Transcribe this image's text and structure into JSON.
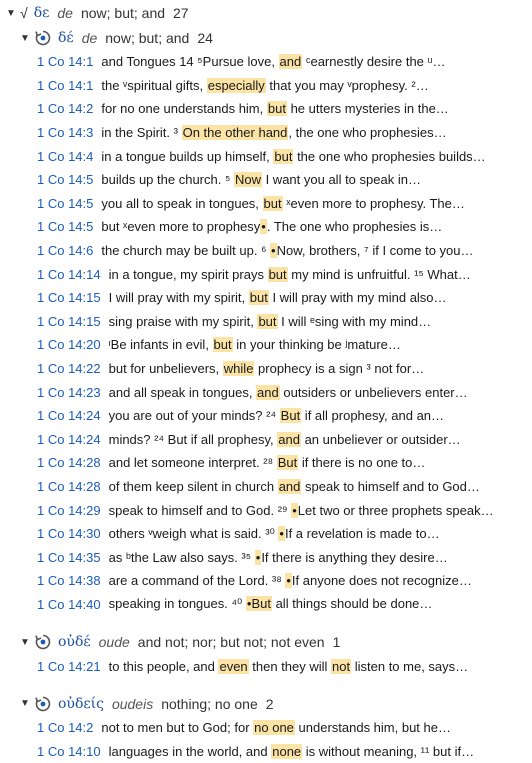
{
  "root": {
    "lemma": "δε",
    "translit": "de",
    "gloss": "now; but; and",
    "count": "27"
  },
  "groups": [
    {
      "lemma": "δέ",
      "translit": "de",
      "gloss": "now; but; and",
      "count": "24",
      "lines": [
        {
          "ref": "1 Co 14:1",
          "pre": "and Tongues 14 ⁵Pursue love, ",
          "hl": "and",
          "post": " ᶜearnestly desire the ᵘ…"
        },
        {
          "ref": "1 Co 14:1",
          "pre": "the ᵛspiritual gifts, ",
          "hl": "especially",
          "post": " that you may ᵛprophesy. ²…"
        },
        {
          "ref": "1 Co 14:2",
          "pre": "for no one understands him, ",
          "hl": "but",
          "post": " he utters mysteries in the…"
        },
        {
          "ref": "1 Co 14:3",
          "pre": "in the Spirit. ³ ",
          "hl": "On the other hand",
          "post": ", the one who prophesies…"
        },
        {
          "ref": "1 Co 14:4",
          "pre": "in a tongue builds up himself, ",
          "hl": "but",
          "post": " the one who prophesies builds…"
        },
        {
          "ref": "1 Co 14:5",
          "pre": "builds up the church. ⁵ ",
          "hl": "Now",
          "post": " I want you all to speak in…"
        },
        {
          "ref": "1 Co 14:5",
          "pre": "you all to speak in tongues, ",
          "hl": "but",
          "post": " ˣeven more to prophesy. The…"
        },
        {
          "ref": "1 Co 14:5",
          "pre": "but ˣeven more to prophesy",
          "hl": "•",
          "post": ". The one who prophesies is…"
        },
        {
          "ref": "1 Co 14:6",
          "pre": "the church may be built up. ⁶ ",
          "hl": "•",
          "post": "Now, brothers, ⁷ if I come to you…"
        },
        {
          "ref": "1 Co 14:14",
          "pre": "in a tongue, my spirit prays ",
          "hl": "but",
          "post": " my mind is unfruitful. ¹⁵ What…"
        },
        {
          "ref": "1 Co 14:15",
          "pre": "I will pray with my spirit, ",
          "hl": "but",
          "post": " I will pray with my mind also…"
        },
        {
          "ref": "1 Co 14:15",
          "pre": "sing praise with my spirit, ",
          "hl": "but",
          "post": " I will ᵉsing with my mind…"
        },
        {
          "ref": "1 Co 14:20",
          "pre": "ᶦBe infants in evil, ",
          "hl": "but",
          "post": " in your thinking be ʲmature…"
        },
        {
          "ref": "1 Co 14:22",
          "pre": "but for unbelievers, ",
          "hl": "while",
          "post": " prophecy is a sign ³ not for…"
        },
        {
          "ref": "1 Co 14:23",
          "pre": "and all speak in tongues, ",
          "hl": "and",
          "post": " outsiders or unbelievers enter…"
        },
        {
          "ref": "1 Co 14:24",
          "pre": "you are out of your minds? ²⁴ ",
          "hl": "But",
          "post": " if all prophesy, and an…"
        },
        {
          "ref": "1 Co 14:24",
          "pre": "minds? ²⁴ But if all prophesy, ",
          "hl": "and",
          "post": " an unbeliever or outsider…"
        },
        {
          "ref": "1 Co 14:28",
          "pre": "and let someone interpret. ²⁸ ",
          "hl": "But",
          "post": " if there is no one to…"
        },
        {
          "ref": "1 Co 14:28",
          "pre": "of them keep silent in church ",
          "hl": "and",
          "post": " speak to himself and to God…"
        },
        {
          "ref": "1 Co 14:29",
          "pre": "speak to himself and to God. ²⁹ ",
          "hl": "•",
          "post": "Let two or three prophets speak…"
        },
        {
          "ref": "1 Co 14:30",
          "pre": "others ᵛweigh what is said. ³⁰ ",
          "hl": "•",
          "post": "If a revelation is made to…"
        },
        {
          "ref": "1 Co 14:35",
          "pre": "as ᵇthe Law also says. ³⁵ ",
          "hl": "•",
          "post": "If there is anything they desire…"
        },
        {
          "ref": "1 Co 14:38",
          "pre": "are a command of the Lord. ³⁸ ",
          "hl": "•",
          "post": "If anyone does not recognize…"
        },
        {
          "ref": "1 Co 14:40",
          "pre": "speaking in tongues. ⁴⁰ ",
          "hl": "•But",
          "post": " all things should be done…"
        }
      ]
    },
    {
      "lemma": "οὐδέ",
      "translit": "oude",
      "gloss": "and not; nor; but not; not even",
      "count": "1",
      "lines": [
        {
          "ref": "1 Co 14:21",
          "pre": "to this people, and ",
          "hl": "even",
          "post": " then they will ",
          "hl2": "not",
          "post2": " listen to me, says…"
        }
      ]
    },
    {
      "lemma": "οὐδείς",
      "translit": "oudeis",
      "gloss": "nothing; no one",
      "count": "2",
      "lines": [
        {
          "ref": "1 Co 14:2",
          "pre": "not to men but to God; for ",
          "hl": "no one",
          "post": " understands him, but he…"
        },
        {
          "ref": "1 Co 14:10",
          "pre": "languages in the world, and ",
          "hl": "none",
          "post": " is without meaning, ¹¹ but if…"
        }
      ]
    }
  ]
}
